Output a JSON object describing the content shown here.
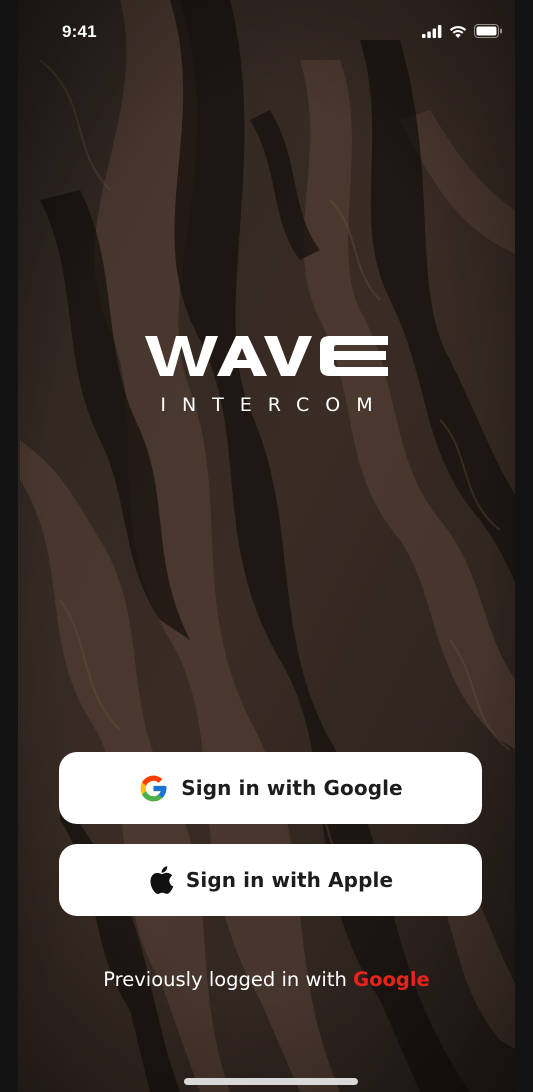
{
  "status_bar": {
    "time": "9:41",
    "icons": [
      "cellular-signal-icon",
      "wifi-icon",
      "battery-icon"
    ]
  },
  "brand": {
    "logo_text": "WAVE",
    "subtitle": "INTERCOM"
  },
  "buttons": {
    "google": {
      "label": "Sign in with Google",
      "icon": "google-icon"
    },
    "apple": {
      "label": "Sign in with Apple",
      "icon": "apple-icon"
    }
  },
  "previous_login": {
    "prefix": "Previously logged in with",
    "provider": "Google"
  },
  "colors": {
    "accent": "#e8231d",
    "button_bg": "#ffffff",
    "button_text": "#1d1d1f",
    "background": "#2a211d"
  }
}
